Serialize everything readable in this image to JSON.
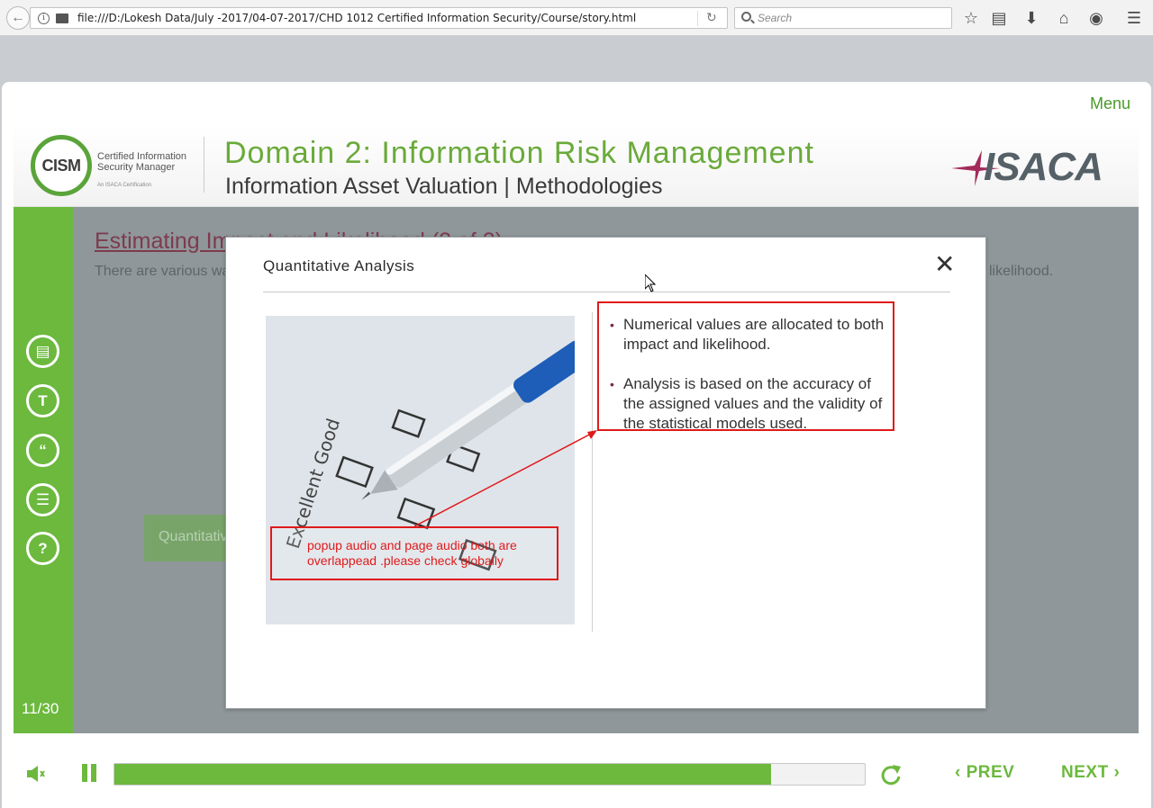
{
  "browser": {
    "url": "file:///D:/Lokesh Data/July -2017/04-07-2017/CHD 1012 Certified Information Security/Course/story.html",
    "search_placeholder": "Search"
  },
  "player": {
    "menu_label": "Menu",
    "logo": {
      "cism_text": "CISM",
      "cism_subtitle_line1": "Certified Information",
      "cism_subtitle_line2": "Security Manager",
      "cism_tagline": "An ISACA Certification",
      "isaca_text": "ISACA"
    },
    "header": {
      "domain_title": "Domain 2: Information Risk Management",
      "subtitle": "Information Asset Valuation | Methodologies"
    },
    "sidebar": {
      "buttons": [
        "notes-icon",
        "transcript-icon",
        "quote-icon",
        "resources-icon",
        "help-icon"
      ],
      "counter": "11/30"
    },
    "slide": {
      "title": "Estimating Impact and Likelihood (2 of 2)",
      "text_start": "There are various wa",
      "text_end": "likelihood.",
      "button_label": "Quantitative"
    },
    "popup": {
      "title": "Quantitative Analysis",
      "bullets": [
        "Numerical values are allocated to both impact and likelihood.",
        "Analysis is based on the accuracy of the assigned values and the validity of the statistical models used."
      ],
      "image_label": "Excellent  Good"
    },
    "review_note": "popup audio and page audio both are overlappead .please check globally",
    "controls": {
      "progress": 0.875,
      "prev_label": "PREV",
      "next_label": "NEXT"
    },
    "colors": {
      "accent_green": "#6cb93e",
      "annotation_red": "#e01a1a",
      "title_maroon": "#7a2b40"
    }
  }
}
